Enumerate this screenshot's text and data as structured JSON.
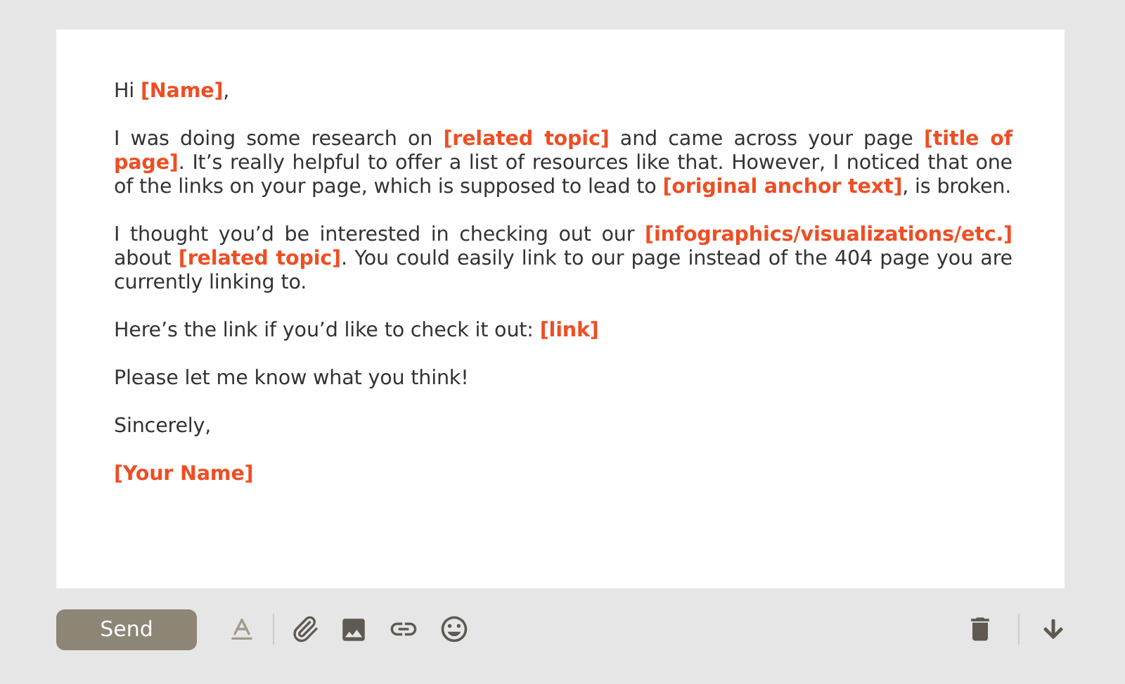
{
  "message": {
    "paragraphs": [
      {
        "kind": "text",
        "text": "Hi **[Name]**,"
      },
      {
        "kind": "text",
        "text": "I was doing some research on **[related topic]** and came across your page **[title of page]**. It’s really helpful to offer a list of resources like that. However, I noticed that one of the links on your page, which is supposed to lead to **[original anchor text]**, is broken."
      },
      {
        "kind": "text",
        "text": "I thought you’d be interested in checking out our **[infographics/visualizations/etc.]** about **[related topic]**. You could easily link to our page instead of the 404 page you are currently linking to."
      },
      {
        "kind": "text",
        "text": "Here’s the link if you’d like to check it out: **[link]**"
      },
      {
        "kind": "text",
        "text": "Please let me know what you think!"
      },
      {
        "kind": "text",
        "text": "Sincerely,"
      },
      {
        "kind": "signature",
        "text": "[Your Name]"
      }
    ]
  },
  "toolbar": {
    "send_button": "Send"
  }
}
